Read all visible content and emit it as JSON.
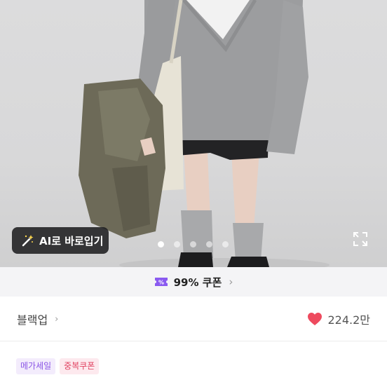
{
  "hero": {
    "ai_button_label": "AI로 바로입기",
    "dots_total": 5,
    "dots_active_index": 0
  },
  "coupon_banner": {
    "text": "99% 쿠폰",
    "chevron": "›"
  },
  "shop": {
    "name": "블랙업",
    "chevron": "›",
    "likes": "224.2만"
  },
  "badges": [
    {
      "label": "메가세일"
    },
    {
      "label": "중복쿠폰"
    }
  ],
  "icons": {
    "ai": "magic-wand-icon",
    "expand": "expand-icon",
    "coupon": "coupon-ticket-icon",
    "heart": "heart-icon"
  },
  "colors": {
    "heart": "#ee4a5e",
    "coupon_icon": "#8a5af0",
    "mega_badge_text": "#8a55e6",
    "dup_badge_text": "#e0405f"
  }
}
